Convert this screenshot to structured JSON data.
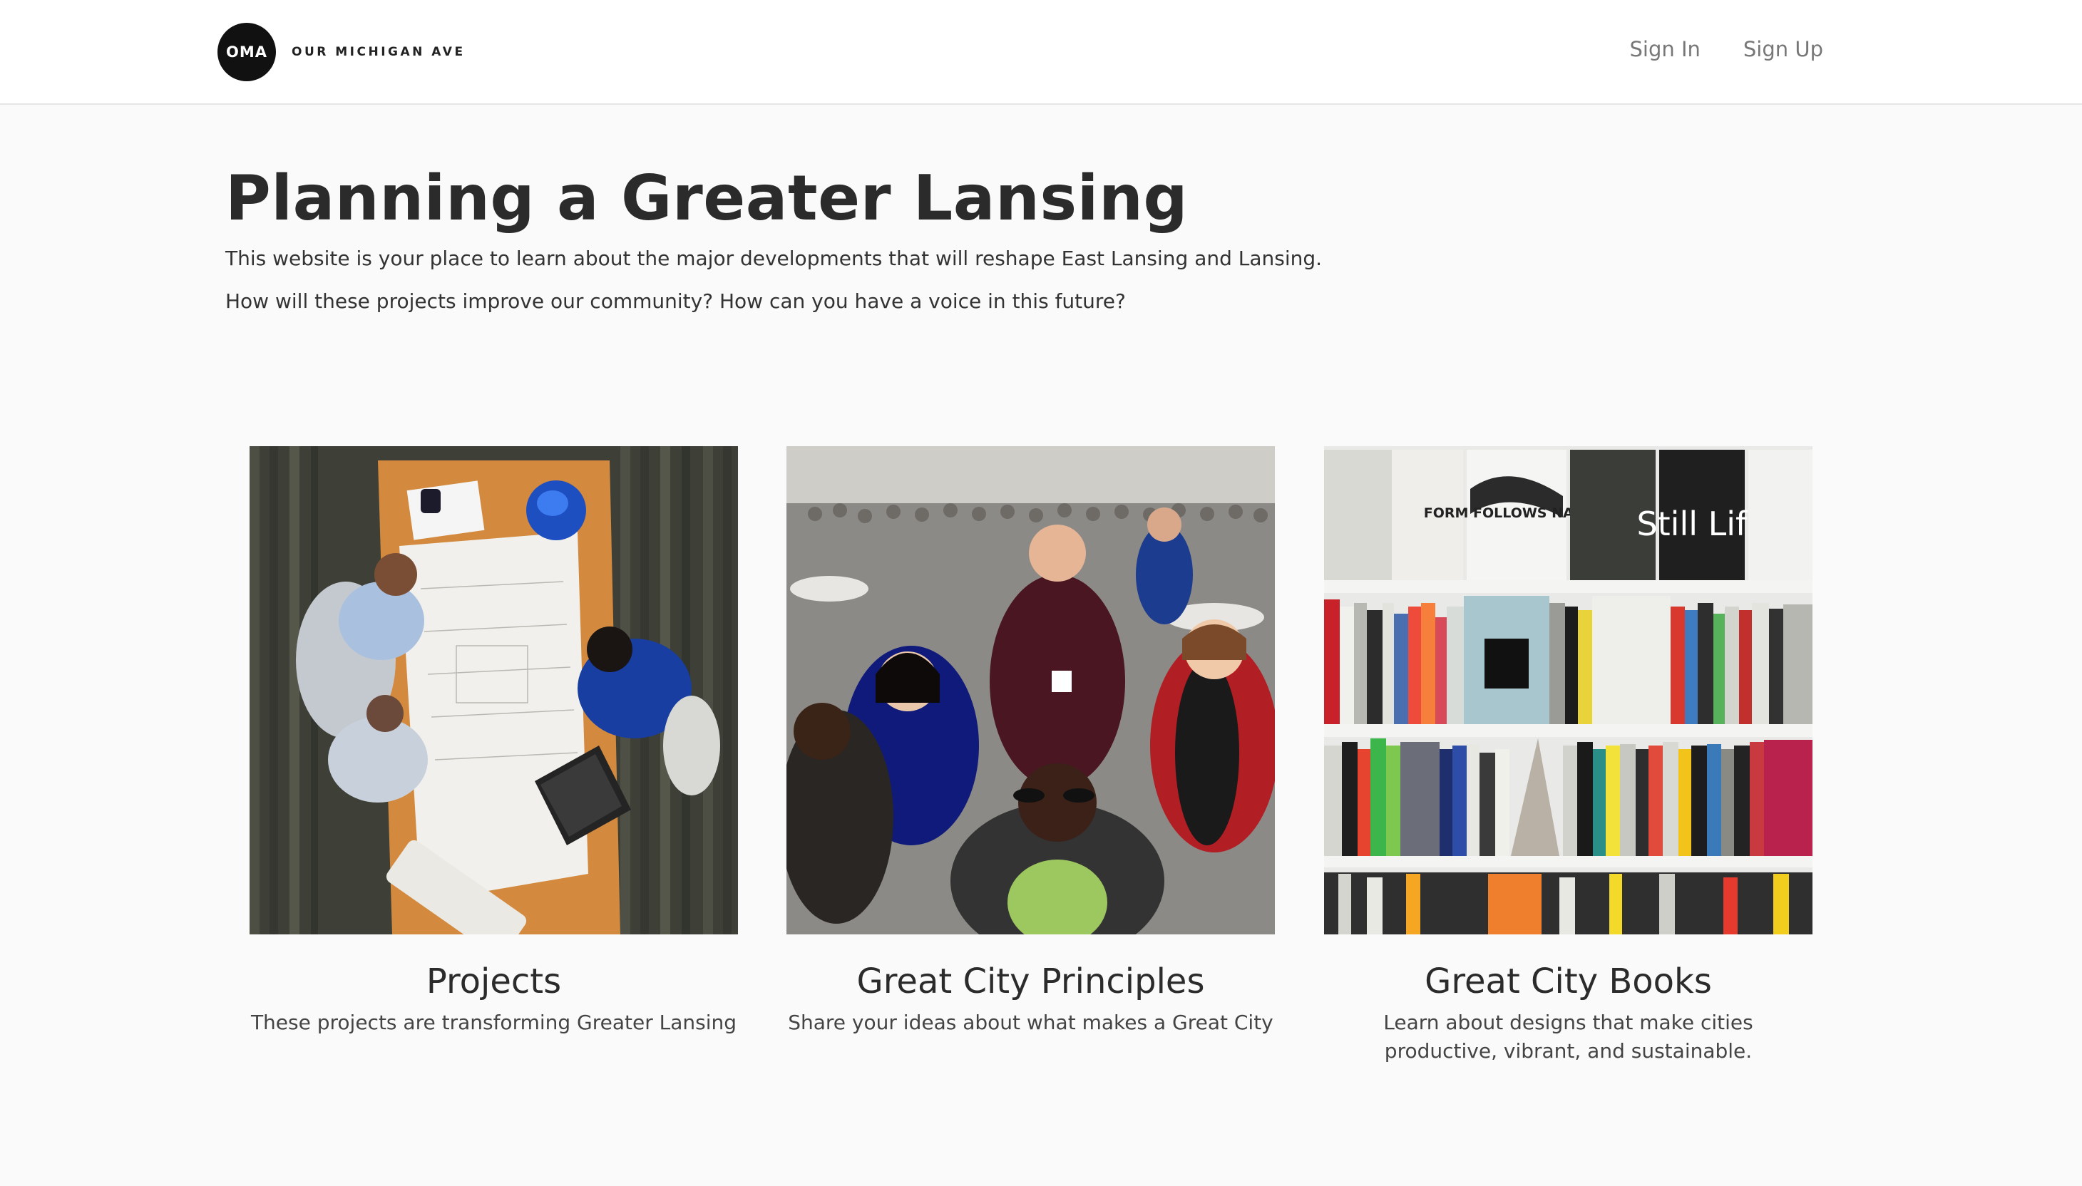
{
  "navbar": {
    "logo_text": "OMA",
    "brand_name": "OUR MICHIGAN AVE",
    "links": [
      {
        "label": "Sign In"
      },
      {
        "label": "Sign Up"
      }
    ]
  },
  "hero": {
    "title": "Planning a Greater Lansing",
    "paragraph_1": "This website is your place to learn about the major developments that will reshape East Lansing and Lansing.",
    "paragraph_2": "How will these projects improve our community? How can you have a voice in this future?"
  },
  "cards": [
    {
      "title": "Projects",
      "description": "These projects are transforming Greater Lansing",
      "image_subject": "overhead view of people planning around a table with blueprints"
    },
    {
      "title": "Great City Principles",
      "description": "Share your ideas about what makes a Great City",
      "image_subject": "crowd of people at a community meeting"
    },
    {
      "title": "Great City Books",
      "description": "Learn about designs that make cities productive, vibrant, and sustainable.",
      "image_subject": "bookshelf filled with urban design books",
      "book_covers": [
        "FORM FOLLOWS NATURE",
        "Still Life"
      ]
    }
  ]
}
